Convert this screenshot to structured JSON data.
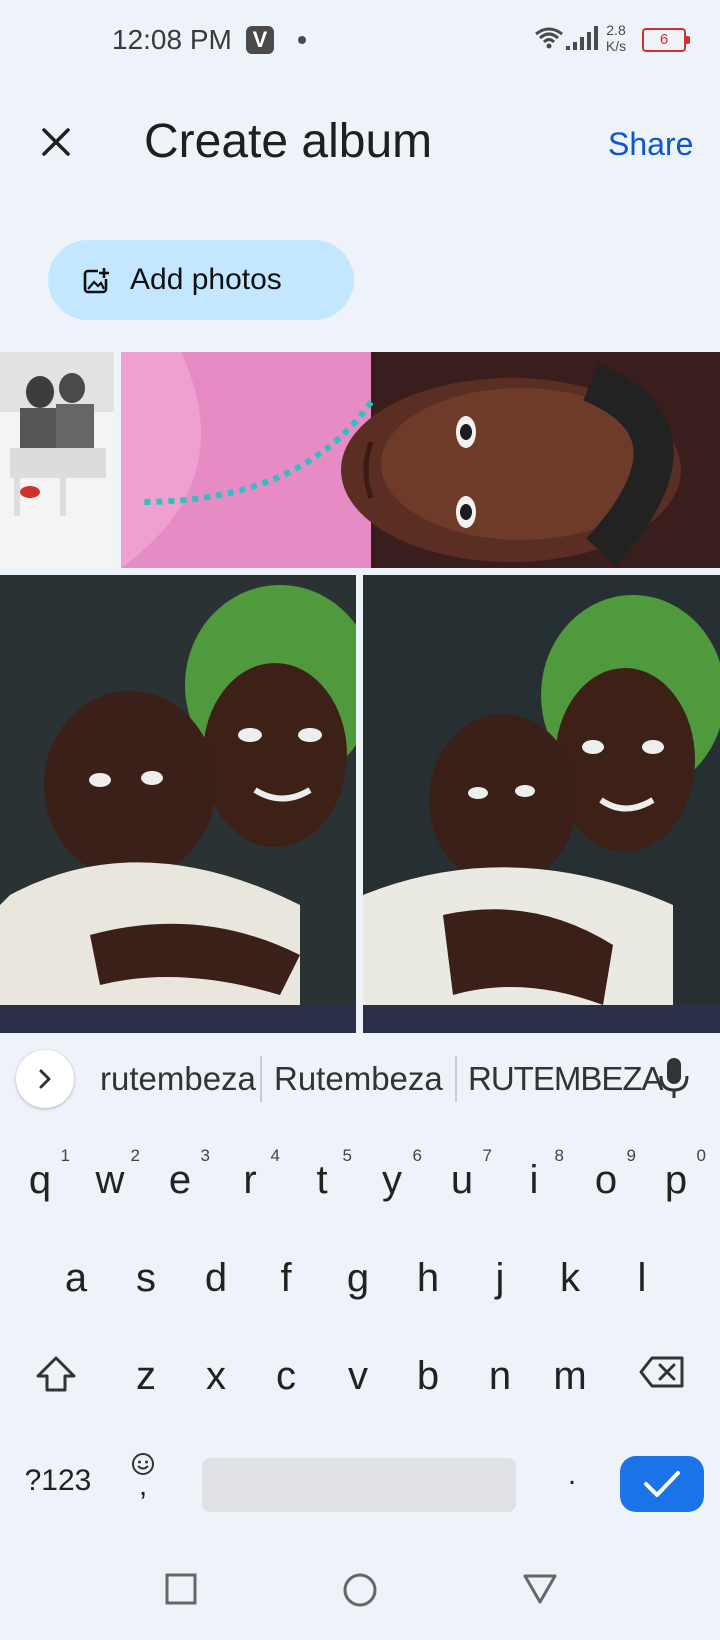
{
  "status_bar": {
    "time": "12:08 PM",
    "app_badge": "V",
    "speed_value": "2.8",
    "speed_unit": "K/s",
    "battery": "6",
    "battery_color": "#d32f2f"
  },
  "header": {
    "title": "Create album",
    "share_label": "Share",
    "close_icon": "close-icon"
  },
  "add_photos": {
    "label": "Add photos",
    "icon": "add-photo-icon",
    "bg_color": "#c2e7ff"
  },
  "photos": [
    {
      "name": "photo-two-people-sitting",
      "description_icon": "photo"
    },
    {
      "name": "photo-selfie-pink-shirt",
      "description_icon": "photo"
    },
    {
      "name": "photo-children-green-hood-1",
      "description_icon": "photo"
    },
    {
      "name": "photo-children-green-hood-2",
      "description_icon": "photo"
    }
  ],
  "suggestions": {
    "items": [
      "rutembeza",
      "Rutembeza",
      "RUTEMBEZA"
    ],
    "expand_icon": "chevron-right-icon",
    "mic_icon": "microphone-icon"
  },
  "keyboard": {
    "row1": [
      {
        "k": "q",
        "h": "1"
      },
      {
        "k": "w",
        "h": "2"
      },
      {
        "k": "e",
        "h": "3"
      },
      {
        "k": "r",
        "h": "4"
      },
      {
        "k": "t",
        "h": "5"
      },
      {
        "k": "y",
        "h": "6"
      },
      {
        "k": "u",
        "h": "7"
      },
      {
        "k": "i",
        "h": "8"
      },
      {
        "k": "o",
        "h": "9"
      },
      {
        "k": "p",
        "h": "0"
      }
    ],
    "row2": [
      "a",
      "s",
      "d",
      "f",
      "g",
      "h",
      "j",
      "k",
      "l"
    ],
    "row3": [
      "z",
      "x",
      "c",
      "v",
      "b",
      "n",
      "m"
    ],
    "symbols_label": "?123",
    "comma_label": ",",
    "period_label": ".",
    "accent_color": "#1a73e8"
  },
  "nav_bar": {
    "recents_icon": "square-icon",
    "home_icon": "circle-icon",
    "back_icon": "triangle-back-icon"
  }
}
